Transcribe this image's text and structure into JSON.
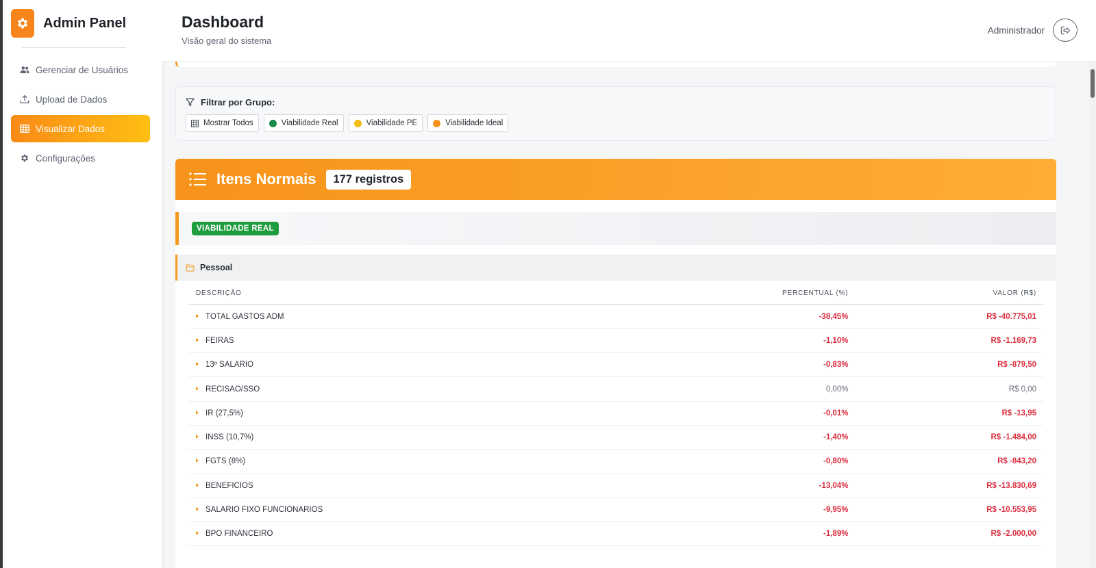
{
  "app": {
    "title": "Admin Panel"
  },
  "colors": {
    "accent": "#f7931a",
    "negative": "#dc2f3f",
    "badge_real": "#1e9d3f",
    "viab_real": "#1a8a4a",
    "viab_pe": "#f6bb14",
    "viab_ideal": "#f7931a"
  },
  "sidebar": {
    "items": [
      {
        "label": "Gerenciar de Usuários",
        "icon": "users-icon",
        "active": false
      },
      {
        "label": "Upload de Dados",
        "icon": "upload-icon",
        "active": false
      },
      {
        "label": "Visualizar Dados",
        "icon": "table-icon",
        "active": true
      },
      {
        "label": "Configurações",
        "icon": "gear-icon",
        "active": false
      }
    ]
  },
  "header": {
    "title": "Dashboard",
    "subtitle": "Visão geral do sistema",
    "user": "Administrador"
  },
  "filter": {
    "label": "Filtrar por Grupo:",
    "buttons": [
      {
        "label": "Mostrar Todos"
      },
      {
        "label": "Viabilidade Real"
      },
      {
        "label": "Viabilidade PE"
      },
      {
        "label": "Viabilidade Ideal"
      }
    ]
  },
  "items": {
    "title": "Itens Normais",
    "count": "177 registros",
    "group_badge": "VIABILIDADE REAL",
    "category": "Pessoal",
    "columns": {
      "description": "DESCRIÇÃO",
      "percent": "PERCENTUAL (%)",
      "value": "VALOR (R$)"
    },
    "rows": [
      {
        "description": "TOTAL GASTOS ADM",
        "percent": "-38,45%",
        "value": "R$ -40.775,01",
        "negative": true
      },
      {
        "description": "FEIRAS",
        "percent": "-1,10%",
        "value": "R$ -1.169,73",
        "negative": true
      },
      {
        "description": "13º SALARIO",
        "percent": "-0,83%",
        "value": "R$ -879,50",
        "negative": true
      },
      {
        "description": "RECISAO/SSO",
        "percent": "0,00%",
        "value": "R$ 0,00",
        "negative": false
      },
      {
        "description": "IR (27,5%)",
        "percent": "-0,01%",
        "value": "R$ -13,95",
        "negative": true
      },
      {
        "description": "INSS (10,7%)",
        "percent": "-1,40%",
        "value": "R$ -1.484,00",
        "negative": true
      },
      {
        "description": "FGTS (8%)",
        "percent": "-0,80%",
        "value": "R$ -843,20",
        "negative": true
      },
      {
        "description": "BENEFICIOS",
        "percent": "-13,04%",
        "value": "R$ -13.830,69",
        "negative": true
      },
      {
        "description": "SALARIO FIXO FUNCIONARIOS",
        "percent": "-9,95%",
        "value": "R$ -10.553,95",
        "negative": true
      },
      {
        "description": "BPO FINANCEIRO",
        "percent": "-1,89%",
        "value": "R$ -2.000,00",
        "negative": true
      }
    ]
  }
}
